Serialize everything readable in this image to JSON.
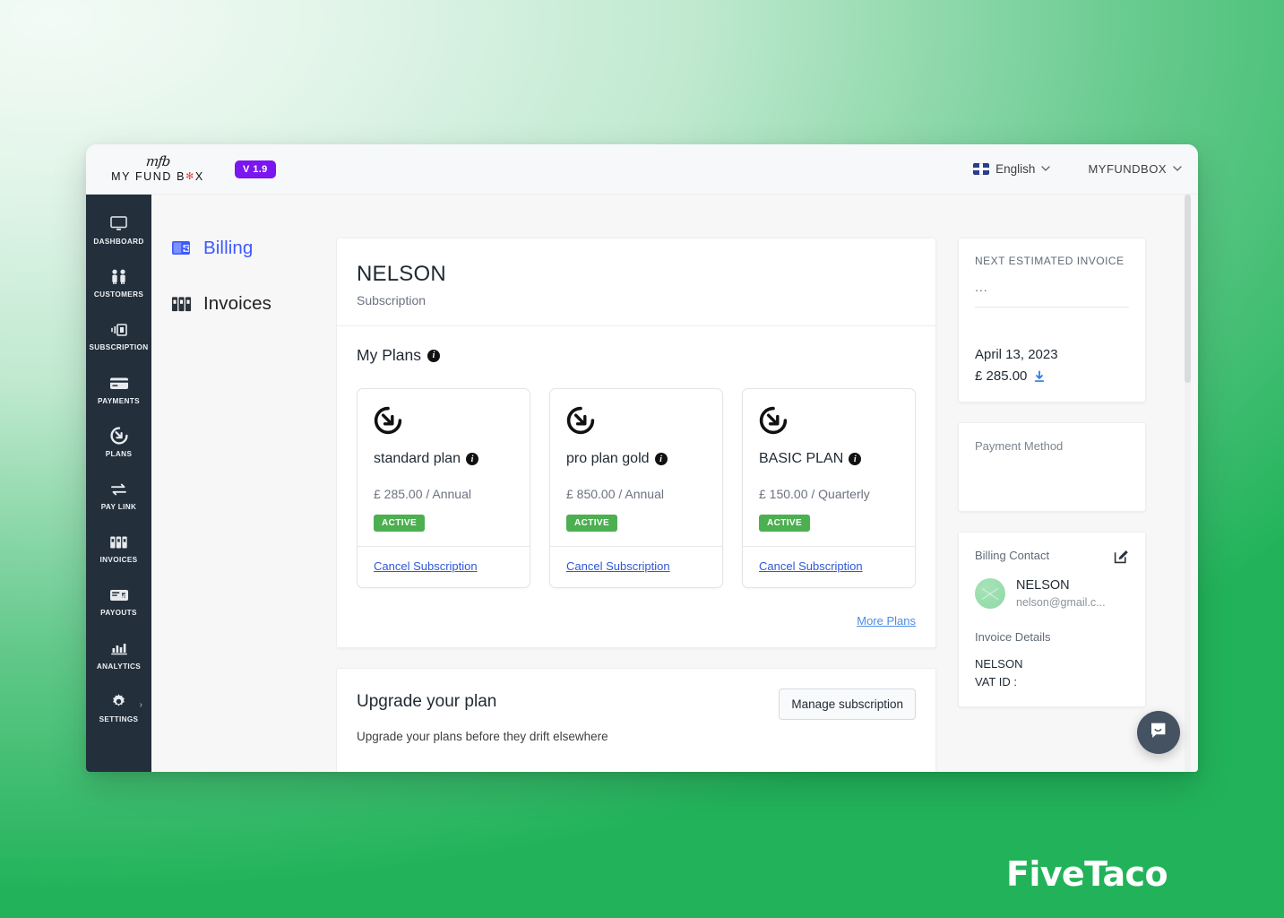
{
  "brand": {
    "mark": "mfb",
    "name_before": "MY FUND B",
    "name_gear": "✻",
    "name_after": "X",
    "version_badge": "V 1.9"
  },
  "topbar": {
    "language": "English",
    "language_chevron": "⌄",
    "account": "MYFUNDBOX",
    "account_chevron": "⌄"
  },
  "rail": {
    "items": [
      {
        "label": "DASHBOARD",
        "icon": "monitor-icon"
      },
      {
        "label": "CUSTOMERS",
        "icon": "people-icon"
      },
      {
        "label": "SUBSCRIPTION",
        "icon": "subscription-icon"
      },
      {
        "label": "PAYMENTS",
        "icon": "credit-card-icon"
      },
      {
        "label": "PLANS",
        "icon": "plans-arrow-icon"
      },
      {
        "label": "PAY LINK",
        "icon": "pay-link-icon"
      },
      {
        "label": "INVOICES",
        "icon": "invoices-icon"
      },
      {
        "label": "PAYOUTS",
        "icon": "payouts-icon"
      },
      {
        "label": "ANALYTICS",
        "icon": "analytics-icon"
      },
      {
        "label": "SETTINGS",
        "icon": "gear-icon"
      }
    ],
    "settings_chevron": "›"
  },
  "subnav": {
    "items": [
      {
        "label": "Billing",
        "icon": "billing-icon",
        "active": true
      },
      {
        "label": "Invoices",
        "icon": "invoices-icon",
        "active": false
      }
    ]
  },
  "subscriber": {
    "name": "NELSON",
    "subtitle": "Subscription"
  },
  "plans_section": {
    "title": "My Plans",
    "info_glyph": "i",
    "more_plans_label": "More Plans",
    "cards": [
      {
        "name": "standard plan",
        "price": "£ 285.00 / Annual",
        "status": "ACTIVE",
        "cancel_label": "Cancel Subscription"
      },
      {
        "name": "pro plan gold",
        "price": "£ 850.00 / Annual",
        "status": "ACTIVE",
        "cancel_label": "Cancel Subscription"
      },
      {
        "name": "BASIC PLAN",
        "price": "£ 150.00 / Quarterly",
        "status": "ACTIVE",
        "cancel_label": "Cancel Subscription"
      }
    ]
  },
  "upgrade": {
    "title": "Upgrade your plan",
    "subtitle": "Upgrade your plans before they drift elsewhere",
    "manage_button": "Manage subscription"
  },
  "next_invoice": {
    "label": "NEXT ESTIMATED INVOICE",
    "placeholder_dots": "...",
    "date": "April 13, 2023",
    "amount": "£ 285.00"
  },
  "payment_method": {
    "label": "Payment Method"
  },
  "billing_contact": {
    "title": "Billing Contact",
    "name": "NELSON",
    "email": "nelson@gmail.c...",
    "invoice_details_title": "Invoice Details",
    "invoice_name": "NELSON",
    "vat_label": "VAT ID :"
  },
  "watermark": "FiveTaco",
  "colors": {
    "accent_blue": "#3d5afe",
    "link_blue": "#2f57d8",
    "more_plans_blue": "#4f8ce0",
    "active_green": "#4caf50",
    "badge_purple": "#7b16f0",
    "rail_dark": "#232f3b",
    "page_green": "#22b35a"
  }
}
